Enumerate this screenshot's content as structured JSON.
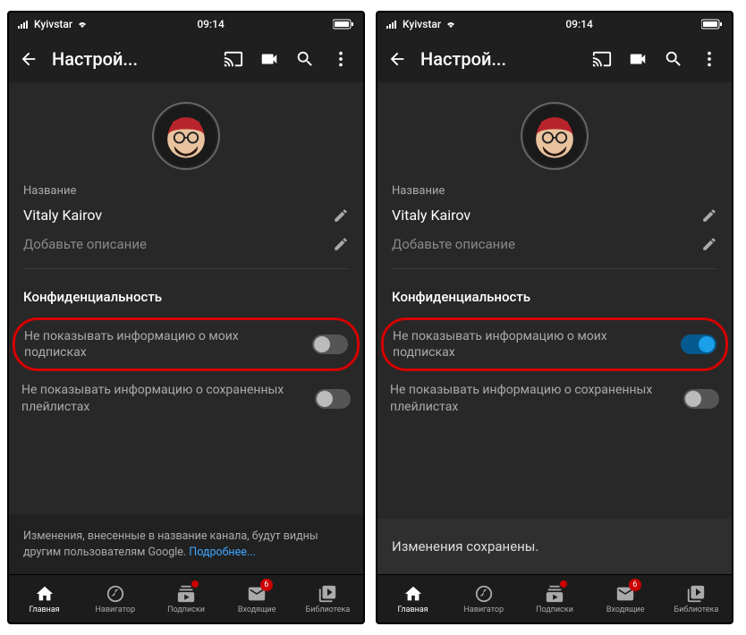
{
  "statusbar": {
    "carrier": "Kyivstar",
    "time": "09:14"
  },
  "header": {
    "title": "Настрой..."
  },
  "profile": {
    "name_label": "Название",
    "name_value": "Vitaly Kairov",
    "desc_placeholder": "Добавьте описание"
  },
  "privacy": {
    "title": "Конфиденциальность",
    "subscriptions": "Не показывать информацию о моих подписках",
    "playlists": "Не показывать информацию о сохраненных плейлистах"
  },
  "notice": {
    "text": "Изменения, внесенные в название канала, будут видны другим пользователям Google. ",
    "link": "Подробнее..."
  },
  "toast": "Изменения сохранены.",
  "nav": {
    "home": "Главная",
    "explore": "Навигатор",
    "subs": "Подписки",
    "inbox": "Входящие",
    "library": "Библиотека",
    "inbox_count": "6"
  }
}
